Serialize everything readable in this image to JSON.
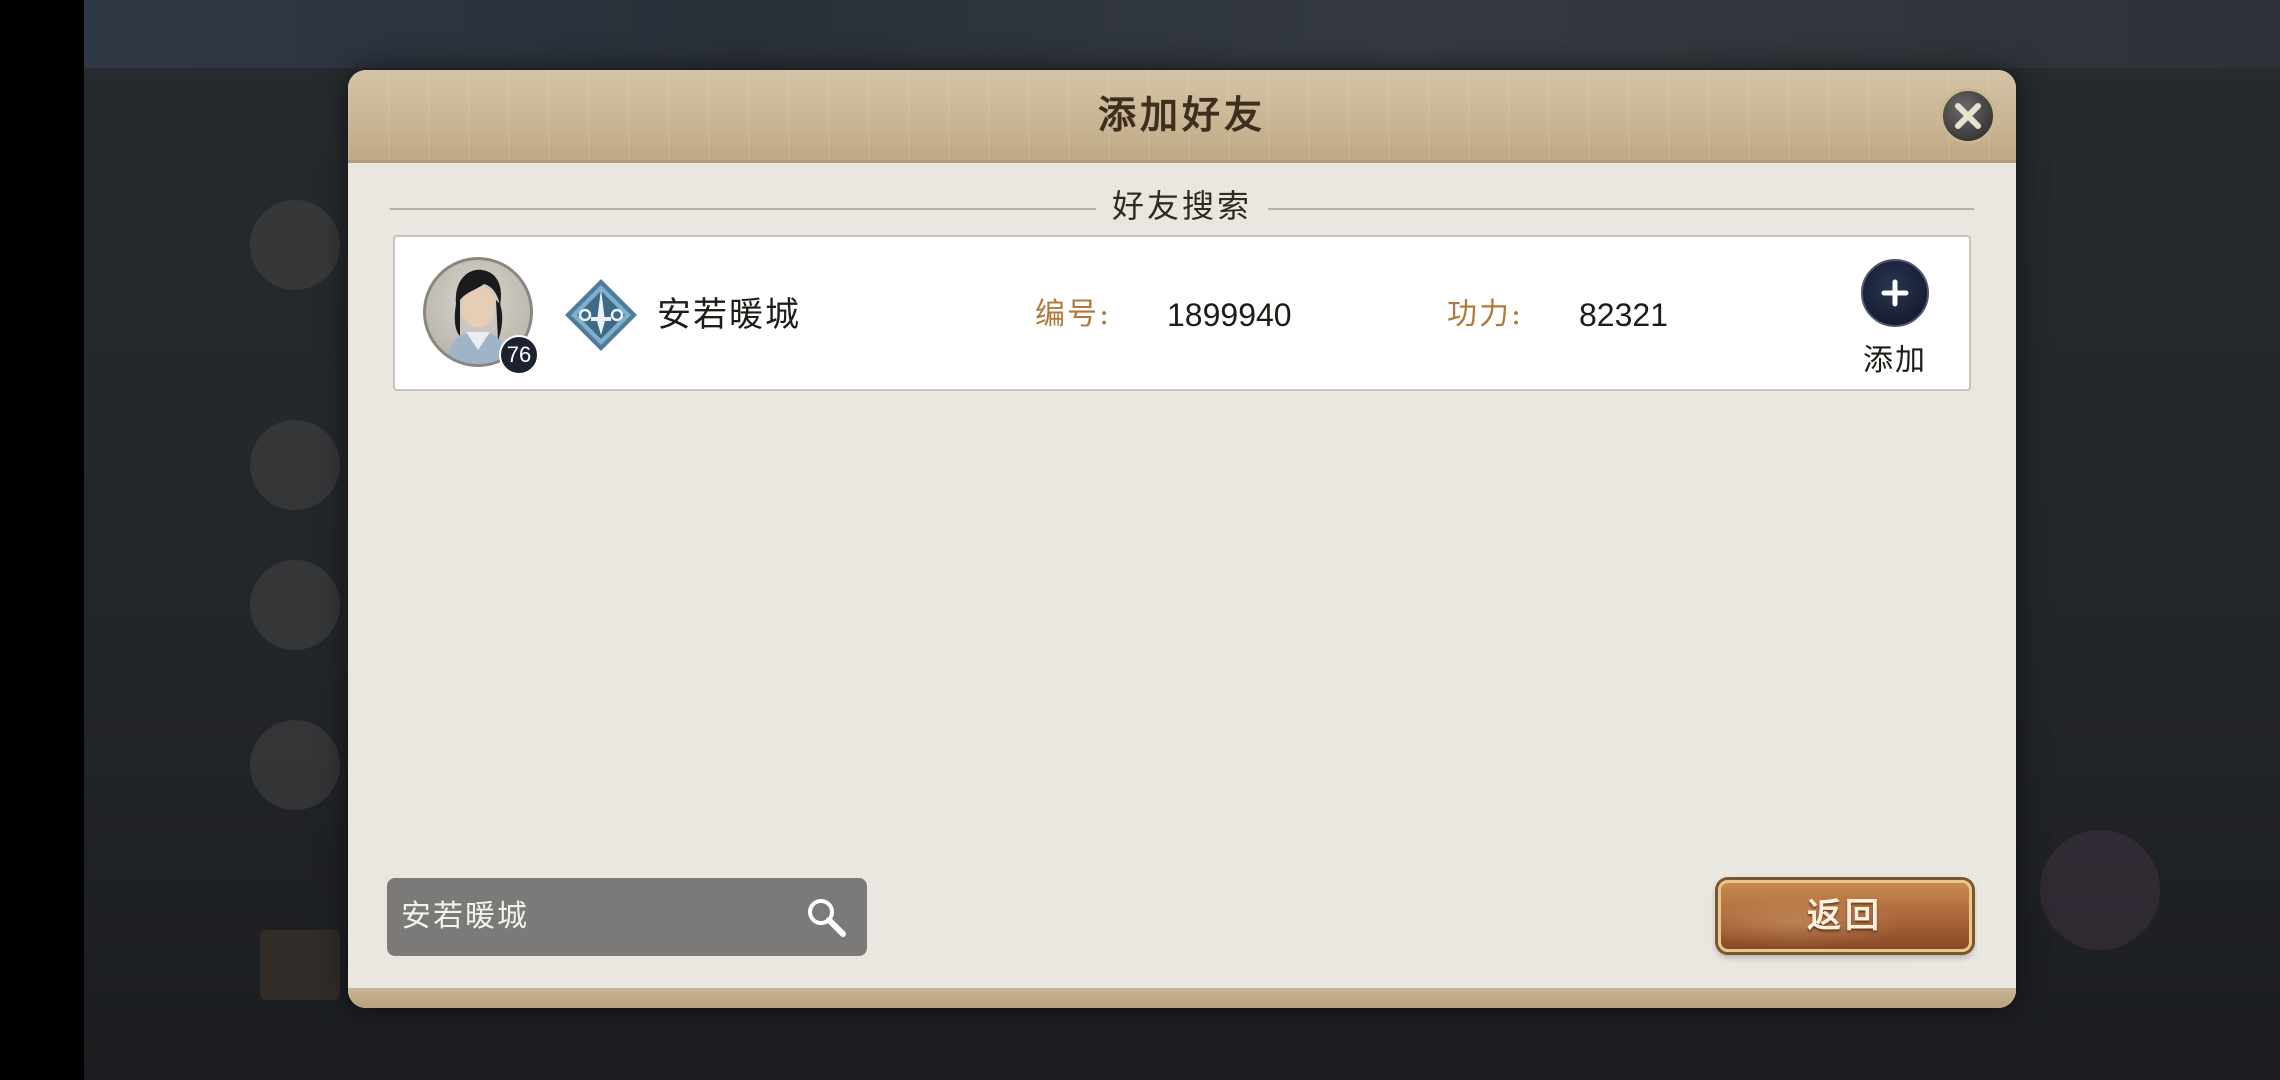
{
  "dialog": {
    "title": "添加好友",
    "section_title": "好友搜索"
  },
  "result": {
    "player_name": "安若暖城",
    "level": "76",
    "id_label": "编号:",
    "id_value": "1899940",
    "power_label": "功力:",
    "power_value": "82321",
    "add_label": "添加"
  },
  "search": {
    "value": "安若暖城"
  },
  "footer": {
    "back_label": "返回"
  },
  "colors": {
    "header_tan": "#c9b594",
    "label_gold": "#b07a3a",
    "button_brown": "#a8643a",
    "add_navy": "#171e33"
  },
  "icons": {
    "close": "close-icon",
    "class": "sword-class-icon",
    "add": "plus-icon",
    "search": "magnifier-icon"
  }
}
